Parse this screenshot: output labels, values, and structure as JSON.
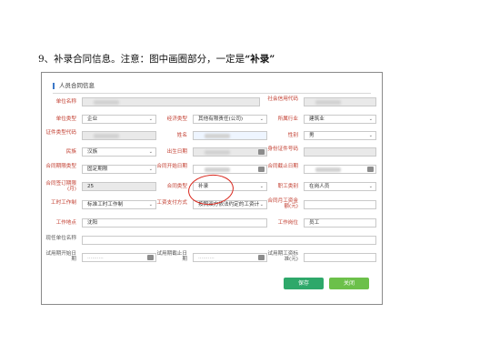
{
  "heading": {
    "prefix": "9、补录合同信息。注意：图中画圈部分，一定是",
    "emph": "“补录”"
  },
  "panel": {
    "title": "人员合同信息",
    "save_label": "保存",
    "close_label": "关闭"
  },
  "labels": {
    "unit_name": "单位名称",
    "credit_code": "社会信用代码",
    "unit_type": "单位类型",
    "econ_type": "经济类型",
    "industry": "所属行业",
    "id_type": "证件类型代码",
    "name": "姓名",
    "gender": "性别",
    "nationality": "民族",
    "birth_date": "出生日期",
    "id_number": "身份证件号码",
    "contract_term": "合同期限类型",
    "contract_start": "合同开始日期",
    "contract_end": "合同截止日期",
    "contract_year": "合同签订期限(月)",
    "contract_status": "合同类型",
    "job_category": "职工类别",
    "work_type": "工时工作制",
    "salary_method": "工资支付方式",
    "monthly_salary": "合同月工资金额(元)",
    "work_place": "工作地点",
    "position": "工作岗位",
    "current_unit": "现任单位名称",
    "probation_start": "试用期开始日期",
    "probation_end": "试用期截止日期",
    "probation_salary": "试用期工资标准(元)"
  },
  "values": {
    "unit_type": "企业",
    "econ_type": "其他有限责任(公司)",
    "industry": "建筑业",
    "gender": "男",
    "nationality": "汉族",
    "contract_term": "固定期限",
    "contract_year": "25",
    "contract_status": "补录",
    "job_category": "在岗人员",
    "work_type": "标准工时工作制",
    "salary_method": "按照双方依法约定的工资计",
    "work_place": "沈阳",
    "position": "员工"
  }
}
